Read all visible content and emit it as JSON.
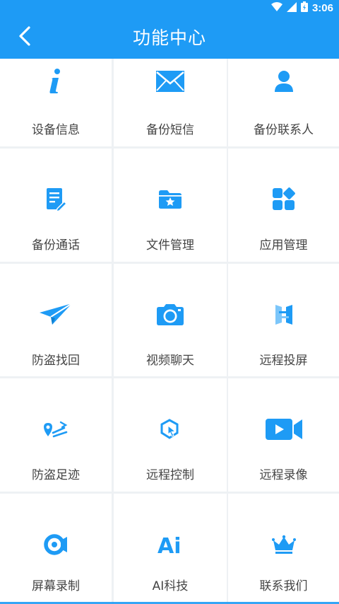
{
  "status": {
    "time": "3:06"
  },
  "header": {
    "title": "功能中心"
  },
  "colors": {
    "accent": "#1e9bf5",
    "icon": "#1e9bf5",
    "label": "#444444"
  },
  "items": [
    {
      "label": "设备信息",
      "icon": "info-icon"
    },
    {
      "label": "备份短信",
      "icon": "envelope-icon"
    },
    {
      "label": "备份联系人",
      "icon": "person-icon"
    },
    {
      "label": "备份通话",
      "icon": "document-edit-icon"
    },
    {
      "label": "文件管理",
      "icon": "folder-star-icon"
    },
    {
      "label": "应用管理",
      "icon": "apps-grid-icon"
    },
    {
      "label": "防盗找回",
      "icon": "paper-plane-icon"
    },
    {
      "label": "视频聊天",
      "icon": "camera-icon"
    },
    {
      "label": "远程投屏",
      "icon": "screen-cast-icon"
    },
    {
      "label": "防盗足迹",
      "icon": "location-route-icon"
    },
    {
      "label": "远程控制",
      "icon": "remote-pointer-icon"
    },
    {
      "label": "远程录像",
      "icon": "video-camera-icon"
    },
    {
      "label": "屏幕录制",
      "icon": "screen-record-icon"
    },
    {
      "label": "AI科技",
      "icon": "ai-icon"
    },
    {
      "label": "联系我们",
      "icon": "crown-icon"
    }
  ]
}
